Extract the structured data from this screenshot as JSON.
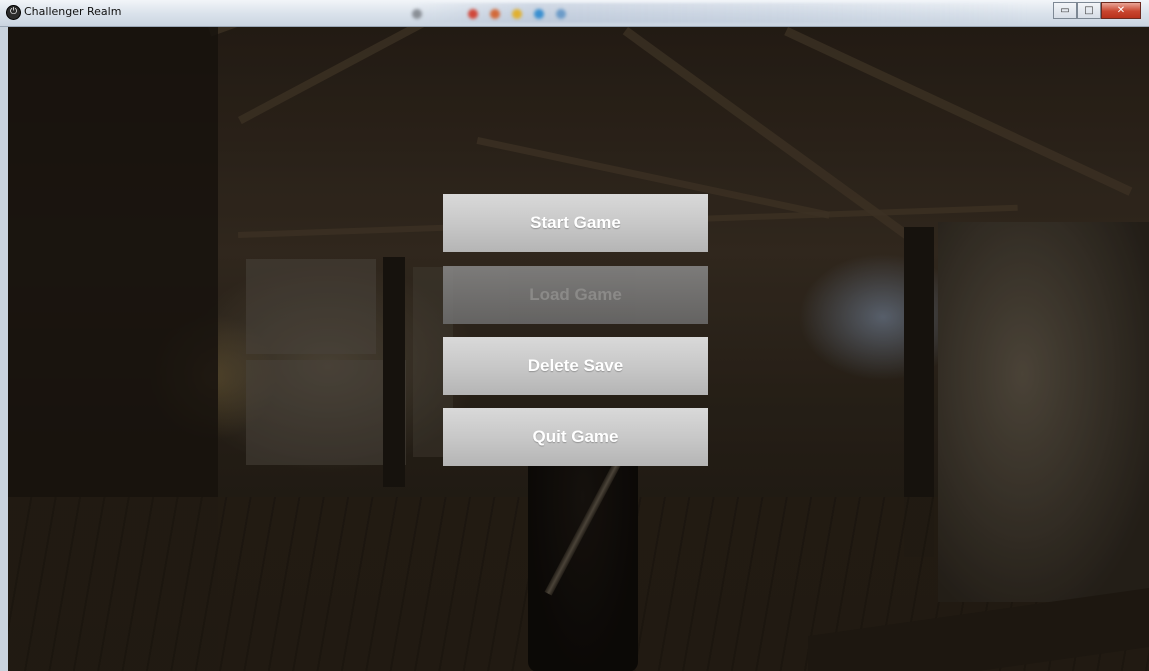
{
  "window": {
    "title": "Challenger Realm",
    "app_icon": "power-icon",
    "controls": {
      "minimize": "▭",
      "maximize": "□",
      "close": "✕"
    }
  },
  "menu": {
    "buttons": [
      {
        "label": "Start Game",
        "enabled": true
      },
      {
        "label": "Load Game",
        "enabled": false
      },
      {
        "label": "Delete Save",
        "enabled": true
      },
      {
        "label": "Quit Game",
        "enabled": true
      }
    ]
  },
  "colors": {
    "button_face": "#c8c8c8",
    "button_disabled": "#7c7c7c",
    "button_text": "#ffffff",
    "close_button": "#c8452e"
  }
}
